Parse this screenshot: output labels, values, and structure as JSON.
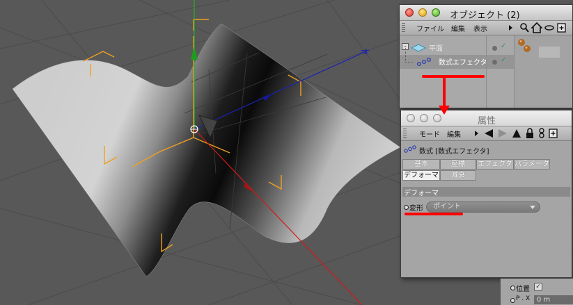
{
  "viewport": {
    "background": "#585858",
    "surface_color": "#cfcfcf",
    "axis_colors": {
      "x": "#d21a1a",
      "y": "#23b123",
      "z": "#1d22b4"
    },
    "bracket_color": "#f0a020"
  },
  "object_manager": {
    "title": "オブジェクト (2)",
    "menu": [
      "ファイル",
      "編集",
      "表示"
    ],
    "toolbar_icons": [
      "search-icon",
      "home-icon",
      "eye-icon",
      "new-window-icon"
    ],
    "objects": [
      {
        "name": "平面",
        "icon": "plane-icon",
        "collapse": "-",
        "selected": false
      },
      {
        "name": "数式エフェクタ",
        "icon": "formula-effector-icon",
        "selected": true
      }
    ]
  },
  "attributes": {
    "title": "属性",
    "menu": [
      "モード",
      "編集"
    ],
    "toolbar_icons": [
      "back-arrow-icon",
      "forward-arrow-icon",
      "up-arrow-icon",
      "lock-icon",
      "link-icon",
      "new-window-icon"
    ],
    "object_title": "数式 [数式エフェクタ]",
    "tabs_row1": [
      "基本",
      "座標",
      "エフェクタ",
      "パラメータ"
    ],
    "tabs_row2": [
      "デフォーマ",
      "減衰"
    ],
    "active_tab": "デフォーマ",
    "section_title": "デフォーマ",
    "field_label": "変形",
    "field_value": "ポイント"
  },
  "bottom_panel": {
    "position_label": "位置",
    "p_label": "P . X",
    "p_value": "0 m"
  },
  "annotations": {
    "color": "#ff0000"
  }
}
